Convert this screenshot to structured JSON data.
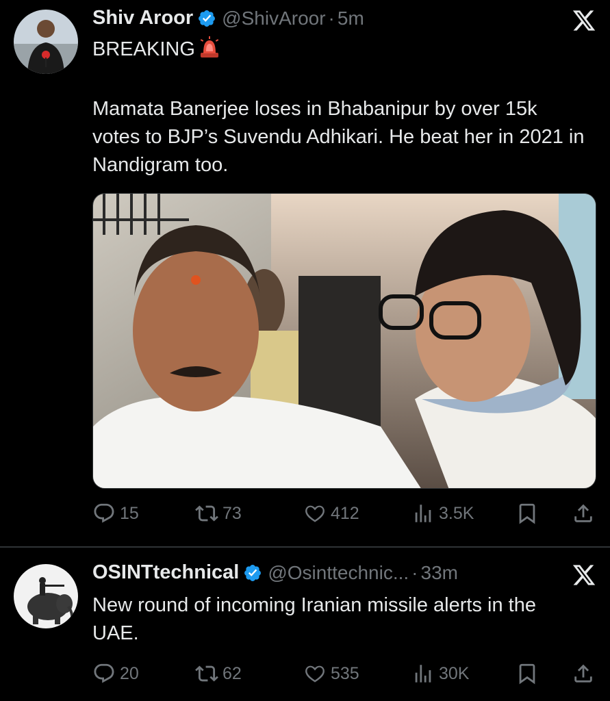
{
  "tweets": [
    {
      "author": "Shiv Aroor",
      "handle": "@ShivAroor",
      "separator": "·",
      "time": "5m",
      "text_line1": "BREAKING",
      "text_body": "Mamata Banerjee loses in Bhabanipur by over 15k votes to BJP’s Suvendu Adhikari. He beat her in 2021 in Nandigram too.",
      "stats": {
        "replies": "15",
        "reposts": "73",
        "likes": "412",
        "views": "3.5K"
      }
    },
    {
      "author": "OSINTtechnical",
      "handle": "@Osinttechnic...",
      "separator": "·",
      "time": "33m",
      "text_body": "New round of incoming Iranian missile alerts in the UAE.",
      "stats": {
        "replies": "20",
        "reposts": "62",
        "likes": "535",
        "views": "30K"
      }
    }
  ],
  "colors": {
    "background": "#000000",
    "text": "#e7e9ea",
    "muted": "#71767b",
    "verified": "#1d9bf0",
    "divider": "#2f3336"
  },
  "icons": [
    "x-logo-icon",
    "verified-badge-icon",
    "siren-emoji-icon",
    "reply-icon",
    "repost-icon",
    "like-icon",
    "views-icon",
    "bookmark-icon",
    "share-icon"
  ]
}
